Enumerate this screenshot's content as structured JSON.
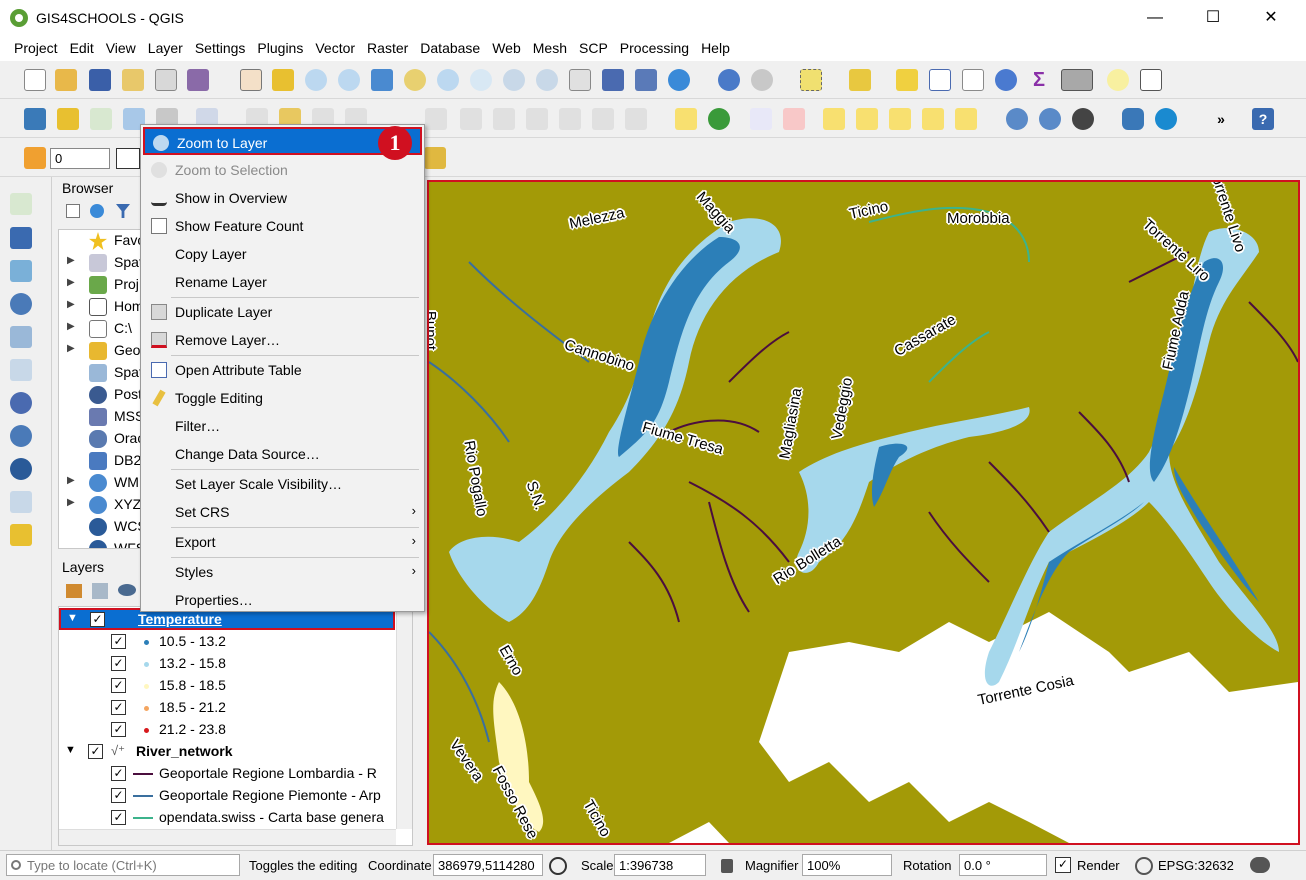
{
  "window": {
    "title": "GIS4SCHOOLS - QGIS",
    "minimize": "—",
    "maximize": "☐",
    "close": "✕"
  },
  "menubar": [
    "Project",
    "Edit",
    "View",
    "Layer",
    "Settings",
    "Plugins",
    "Vector",
    "Raster",
    "Database",
    "Web",
    "Mesh",
    "SCP",
    "Processing",
    "Help"
  ],
  "toolbar3": {
    "spin_value": "0"
  },
  "browser": {
    "title": "Browser",
    "items": [
      {
        "label": "Favo",
        "icon": "star-icon",
        "expand": false
      },
      {
        "label": "Spat",
        "icon": "spatial-bookmarks-icon",
        "expand": true
      },
      {
        "label": "Proj",
        "icon": "project-home-icon",
        "expand": true
      },
      {
        "label": "Hom",
        "icon": "home-icon",
        "expand": true
      },
      {
        "label": "C:\\",
        "icon": "folder-icon",
        "expand": true
      },
      {
        "label": "Geo",
        "icon": "geopackage-icon",
        "expand": true
      },
      {
        "label": "Spat",
        "icon": "spatialite-icon",
        "expand": false
      },
      {
        "label": "Post",
        "icon": "postgis-icon",
        "expand": false
      },
      {
        "label": "MSS",
        "icon": "mssql-icon",
        "expand": false
      },
      {
        "label": "Orac",
        "icon": "oracle-icon",
        "expand": false
      },
      {
        "label": "DB2",
        "icon": "db2-icon",
        "expand": false
      },
      {
        "label": "WM",
        "icon": "wms-icon",
        "expand": true
      },
      {
        "label": "XYZ",
        "icon": "xyz-icon",
        "expand": true
      },
      {
        "label": "WCS",
        "icon": "wcs-icon",
        "expand": false
      },
      {
        "label": "WFS",
        "icon": "wfs-icon",
        "expand": false
      }
    ]
  },
  "layers": {
    "title": "Layers",
    "temperature": {
      "name": "Temperature",
      "classes": [
        {
          "label": "10.5 - 13.2",
          "color": "#2c7fb8"
        },
        {
          "label": "13.2 - 15.8",
          "color": "#a6d8ec"
        },
        {
          "label": "15.8 - 18.5",
          "color": "#fff7c0"
        },
        {
          "label": "18.5 - 21.2",
          "color": "#f4a560"
        },
        {
          "label": "21.2 - 23.8",
          "color": "#d7191c"
        }
      ]
    },
    "river_network": {
      "name": "River_network",
      "classes": [
        {
          "label": "Geoportale Regione Lombardia - R",
          "color": "#4b0e3e"
        },
        {
          "label": "Geoportale Regione Piemonte - Arp",
          "color": "#3a6f9e"
        },
        {
          "label": "opendata.swiss - Carta base genera",
          "color": "#3cb38c"
        }
      ]
    }
  },
  "context_menu": {
    "items": [
      {
        "label": "Zoom to Layer",
        "icon": "zoom-to-layer-icon",
        "enabled": true,
        "highlighted": true
      },
      {
        "label": "Zoom to Selection",
        "icon": "zoom-to-selection-icon",
        "enabled": false
      },
      {
        "label": "Show in Overview",
        "icon": "overview-glasses-icon",
        "enabled": true
      },
      {
        "label": "Show Feature Count",
        "icon": "checkbox-icon",
        "enabled": true,
        "checkbox": true
      },
      {
        "label": "Copy Layer",
        "icon": "",
        "enabled": true
      },
      {
        "label": "Rename Layer",
        "icon": "",
        "enabled": true
      },
      {
        "label": "Duplicate Layer",
        "icon": "duplicate-layer-icon",
        "enabled": true
      },
      {
        "label": "Remove Layer…",
        "icon": "remove-layer-icon",
        "enabled": true
      },
      {
        "label": "Open Attribute Table",
        "icon": "attribute-table-icon",
        "enabled": true
      },
      {
        "label": "Toggle Editing",
        "icon": "pencil-icon",
        "enabled": true
      },
      {
        "label": "Filter…",
        "icon": "",
        "enabled": true
      },
      {
        "label": "Change Data Source…",
        "icon": "",
        "enabled": true
      },
      {
        "label": "Set Layer Scale Visibility…",
        "icon": "",
        "enabled": true
      },
      {
        "label": "Set CRS",
        "icon": "",
        "enabled": true,
        "submenu": true
      },
      {
        "label": "Export",
        "icon": "",
        "enabled": true,
        "submenu": true
      },
      {
        "label": "Styles",
        "icon": "",
        "enabled": true,
        "submenu": true
      },
      {
        "label": "Properties…",
        "icon": "",
        "enabled": true
      }
    ],
    "step_marker": "1"
  },
  "map": {
    "labels": [
      {
        "text": "Melezza",
        "rot": -12
      },
      {
        "text": "Maggia",
        "rot": 48
      },
      {
        "text": "Ticino",
        "rot": -12
      },
      {
        "text": "Morobbia",
        "rot": 0
      },
      {
        "text": "Torrente Liro",
        "rot": 42
      },
      {
        "text": "Torrente Livo",
        "rot": 72
      },
      {
        "text": "Cannobino",
        "rot": 18
      },
      {
        "text": "Cassarate",
        "rot": -30
      },
      {
        "text": "Fiume Adda",
        "rot": -78
      },
      {
        "text": "Magliasina",
        "rot": -80
      },
      {
        "text": "Vedeggio",
        "rot": -80
      },
      {
        "text": "Fiume Tresa",
        "rot": 16
      },
      {
        "text": "Rio Pogallo",
        "rot": 80
      },
      {
        "text": "S.N.",
        "rot": 70
      },
      {
        "text": "Rio Bolletta",
        "rot": -32
      },
      {
        "text": "Erno",
        "rot": 60
      },
      {
        "text": "Torrente Cosia",
        "rot": -12
      },
      {
        "text": "Vevera",
        "rot": 55
      },
      {
        "text": "Fosso Rese",
        "rot": 62
      },
      {
        "text": "Ticino",
        "rot": 60
      },
      {
        "text": "Bunot",
        "rot": 90
      }
    ]
  },
  "statusbar": {
    "locate_placeholder": "Type to locate (Ctrl+K)",
    "message": "Toggles the editing",
    "coordinate_label": "Coordinate",
    "coordinate_value": "386979,5114280",
    "scale_label": "Scale",
    "scale_value": "1:396738",
    "magnifier_label": "Magnifier",
    "magnifier_value": "100%",
    "rotation_label": "Rotation",
    "rotation_value": "0.0 °",
    "render_label": "Render",
    "crs": "EPSG:32632"
  },
  "colors": {
    "highlight": "#0a6ed1",
    "annotation_red": "#d01020",
    "land": "#a39a07"
  }
}
